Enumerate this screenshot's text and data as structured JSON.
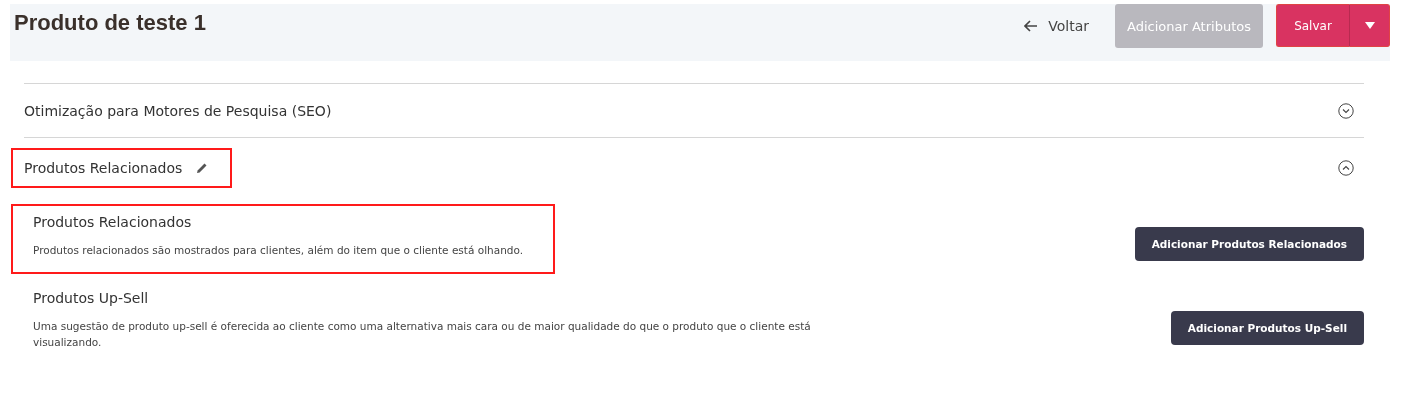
{
  "header": {
    "title": "Produto de teste 1",
    "back": "Voltar",
    "buttons": [
      {
        "label": "Adicionar Atributos",
        "disabled": true
      },
      {
        "label": "Salvar",
        "disabled": false
      }
    ]
  },
  "sections": [
    {
      "title": "Otimização para Motores de Pesquisa (SEO)",
      "expanded": false,
      "editable": false,
      "highlighted": false
    },
    {
      "title": "Produtos Relacionados",
      "expanded": true,
      "editable": true,
      "highlighted": true
    }
  ],
  "groups": [
    {
      "title": "Produtos Relacionados",
      "description": "Produtos relacionados são mostrados para clientes, além do item que o cliente está olhando.",
      "button": "Adicionar Produtos Relacionados",
      "highlighted": true
    },
    {
      "title": "Produtos Up-Sell",
      "description": "Uma sugestão de produto up-sell é oferecida ao cliente como uma alternativa mais cara ou de maior qualidade do que o produto que o cliente está visualizando.",
      "button": "Adicionar Produtos Up-Sell",
      "highlighted": false
    }
  ]
}
